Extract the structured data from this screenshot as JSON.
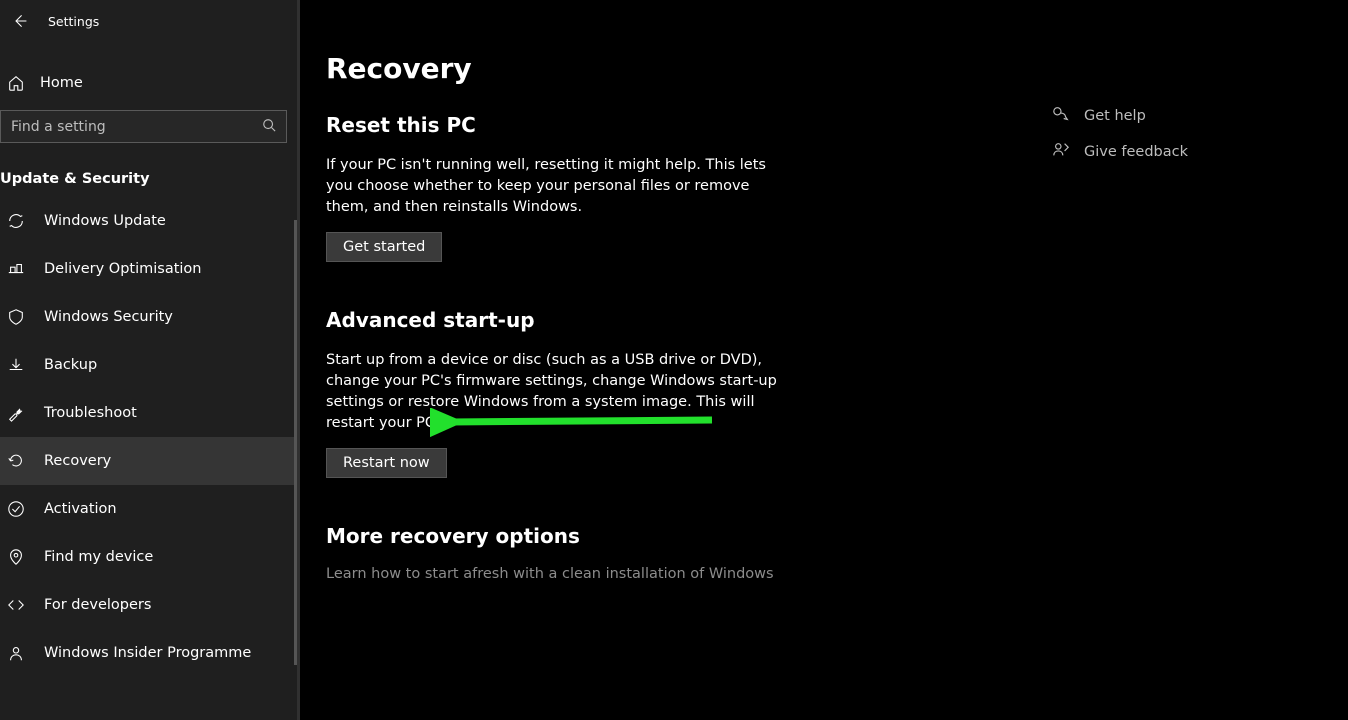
{
  "window": {
    "title": "Settings"
  },
  "sidebar": {
    "home": "Home",
    "search_placeholder": "Find a setting",
    "group": "Update & Security",
    "items": [
      {
        "label": "Windows Update"
      },
      {
        "label": "Delivery Optimisation"
      },
      {
        "label": "Windows Security"
      },
      {
        "label": "Backup"
      },
      {
        "label": "Troubleshoot"
      },
      {
        "label": "Recovery",
        "selected": true
      },
      {
        "label": "Activation"
      },
      {
        "label": "Find my device"
      },
      {
        "label": "For developers"
      },
      {
        "label": "Windows Insider Programme"
      }
    ]
  },
  "main": {
    "title": "Recovery",
    "reset": {
      "heading": "Reset this PC",
      "body": "If your PC isn't running well, resetting it might help. This lets you choose whether to keep your personal files or remove them, and then reinstalls Windows.",
      "button": "Get started"
    },
    "advanced": {
      "heading": "Advanced start-up",
      "body": "Start up from a device or disc (such as a USB drive or DVD), change your PC's firmware settings, change Windows start-up settings or restore Windows from a system image. This will restart your PC.",
      "button": "Restart now"
    },
    "more": {
      "heading": "More recovery options",
      "link": "Learn how to start afresh with a clean installation of Windows"
    }
  },
  "right": {
    "help": "Get help",
    "feedback": "Give feedback"
  }
}
